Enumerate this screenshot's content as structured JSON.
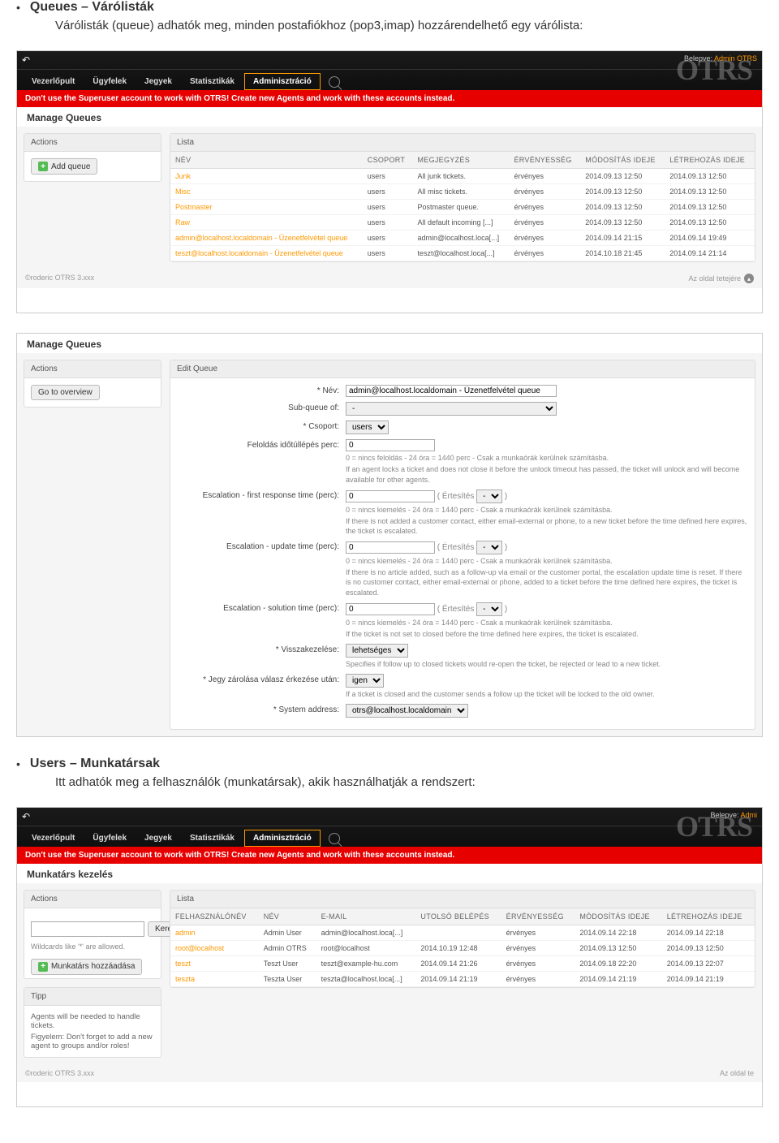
{
  "doc": {
    "queues_title": "Queues – Várólisták",
    "queues_desc": "Várólisták (queue) adhatók meg, minden postafiókhoz (pop3,imap) hozzárendelhető egy várólista:",
    "users_title": "Users – Munkatársak",
    "users_desc": "Itt adhatók meg a felhasználók (munkatársak), akik használhatják a rendszert:"
  },
  "common": {
    "welcome_prefix": "Belepve:",
    "welcome_user": "Admin OTRS",
    "back_icon": "↶",
    "nav": {
      "dash": "Vezerlőpult",
      "cust": "Ügyfelek",
      "tick": "Jegyek",
      "stat": "Statisztikák",
      "admin": "Adminisztráció"
    },
    "warning": "Don't use the Superuser account to work with OTRS! Create new Agents and work with these accounts instead.",
    "powered": "©roderic OTRS 3.xxx",
    "totop": "Az oldal tetejére",
    "actions": "Actions",
    "list": "Lista"
  },
  "queues_list": {
    "page_title": "Manage Queues",
    "add_btn": "Add queue",
    "cols": {
      "name": "NÉV",
      "group": "CSOPORT",
      "comment": "MEGJEGYZÉS",
      "valid": "ÉRVÉNYESSÉG",
      "changed": "MÓDOSÍTÁS IDEJE",
      "created": "LÉTREHOZÁS IDEJE"
    },
    "rows": [
      {
        "name": "Junk",
        "group": "users",
        "comment": "All junk tickets.",
        "valid": "érvényes",
        "changed": "2014.09.13 12:50",
        "created": "2014.09.13 12:50"
      },
      {
        "name": "Misc",
        "group": "users",
        "comment": "All misc tickets.",
        "valid": "érvényes",
        "changed": "2014.09.13 12:50",
        "created": "2014.09.13 12:50"
      },
      {
        "name": "Postmaster",
        "group": "users",
        "comment": "Postmaster queue.",
        "valid": "érvényes",
        "changed": "2014.09.13 12:50",
        "created": "2014.09.13 12:50"
      },
      {
        "name": "Raw",
        "group": "users",
        "comment": "All default incoming [...]",
        "valid": "érvényes",
        "changed": "2014.09.13 12:50",
        "created": "2014.09.13 12:50"
      },
      {
        "name": "admin@localhost.localdomain - Üzenetfelvétel queue",
        "group": "users",
        "comment": "admin@localhost.loca[...]",
        "valid": "érvényes",
        "changed": "2014.09.14 21:15",
        "created": "2014.09.14 19:49"
      },
      {
        "name": "teszt@localhost.localdomain - Üzenetfelvétel queue",
        "group": "users",
        "comment": "teszt@localhost.loca[...]",
        "valid": "érvényes",
        "changed": "2014.10.18 21:45",
        "created": "2014.09.14 21:14"
      }
    ]
  },
  "queues_edit": {
    "page_title": "Manage Queues",
    "goto": "Go to overview",
    "head": "Edit Queue",
    "lbl": {
      "name": "Név:",
      "sub": "Sub-queue of:",
      "group": "Csoport:",
      "unlock": "Feloldás időtúllépés perc:",
      "esc_first": "Escalation - first response time (perc):",
      "esc_update": "Escalation - update time (perc):",
      "esc_solution": "Escalation - solution time (perc):",
      "reopen": "Visszakezelése:",
      "lockafter": "Jegy zárolása válasz érkezése után:",
      "sysaddr": "System address:"
    },
    "val": {
      "name": "admin@localhost.localdomain - Üzenetfelvétel queue",
      "sub": "-",
      "group": "users",
      "unlock": "0",
      "esc_first": "0",
      "esc_update": "0",
      "esc_solution": "0",
      "notify": "Értesítés",
      "notify_sel": "-",
      "reopen": "lehetséges",
      "lockafter": "igen",
      "sysaddr": "otrs@localhost.localdomain"
    },
    "hint": {
      "unlock1": "0 = nincs feloldás - 24 óra = 1440 perc - Csak a munkaórák kerülnek számításba.",
      "unlock2": "If an agent locks a ticket and does not close it before the unlock timeout has passed, the ticket will unlock and will become available for other agents.",
      "esc1": "0 = nincs kiemelés - 24 óra = 1440 perc - Csak a munkaórák kerülnek számításba.",
      "first2": "If there is not added a customer contact, either email-external or phone, to a new ticket before the time defined here expires, the ticket is escalated.",
      "update2": "If there is no article added, such as a follow-up via email or the customer portal, the escalation update time is reset. If there is no customer contact, either email-external or phone, added to a ticket before the time defined here expires, the ticket is escalated.",
      "solution2": "If the ticket is not set to closed before the time defined here expires, the ticket is escalated.",
      "reopen": "Specifies if follow up to closed tickets would re-open the ticket, be rejected or lead to a new ticket.",
      "lockafter": "If a ticket is closed and the customer sends a follow up the ticket will be locked to the old owner."
    }
  },
  "users": {
    "page_title": "Munkatárs kezelés",
    "add_btn": "Munkatárs hozzáadása",
    "search_btn": "Keresés",
    "search_hint": "Wildcards like '*' are allowed.",
    "tip_head": "Tipp",
    "tip1": "Agents will be needed to handle tickets.",
    "tip2": "Figyelem: Don't forget to add a new agent to groups and/or roles!",
    "cols": {
      "user": "FELHASZNÁLÓNÉV",
      "name": "NÉV",
      "email": "E-MAIL",
      "last": "UTOLSÓ BELÉPÉS",
      "valid": "ÉRVÉNYESSÉG",
      "changed": "MÓDOSÍTÁS IDEJE",
      "created": "LÉTREHOZÁS IDEJE"
    },
    "rows": [
      {
        "user": "admin",
        "name": "Admin User",
        "email": "admin@localhost.loca[...]",
        "last": "",
        "valid": "érvényes",
        "changed": "2014.09.14 22:18",
        "created": "2014.09.14 22:18"
      },
      {
        "user": "root@localhost",
        "name": "Admin OTRS",
        "email": "root@localhost",
        "last": "2014.10.19 12:48",
        "valid": "érvényes",
        "changed": "2014.09.13 12:50",
        "created": "2014.09.13 12:50"
      },
      {
        "user": "teszt",
        "name": "Teszt User",
        "email": "teszt@example-hu.com",
        "last": "2014.09.14 21:26",
        "valid": "érvényes",
        "changed": "2014.09.18 22:20",
        "created": "2014.09.13 22:07"
      },
      {
        "user": "teszta",
        "name": "Teszta User",
        "email": "teszta@localhost.loca[...]",
        "last": "2014.09.14 21:19",
        "valid": "érvényes",
        "changed": "2014.09.14 21:19",
        "created": "2014.09.14 21:19"
      }
    ],
    "powered": "©roderic OTRS 3.xxx",
    "totop": "Az oldal te"
  }
}
